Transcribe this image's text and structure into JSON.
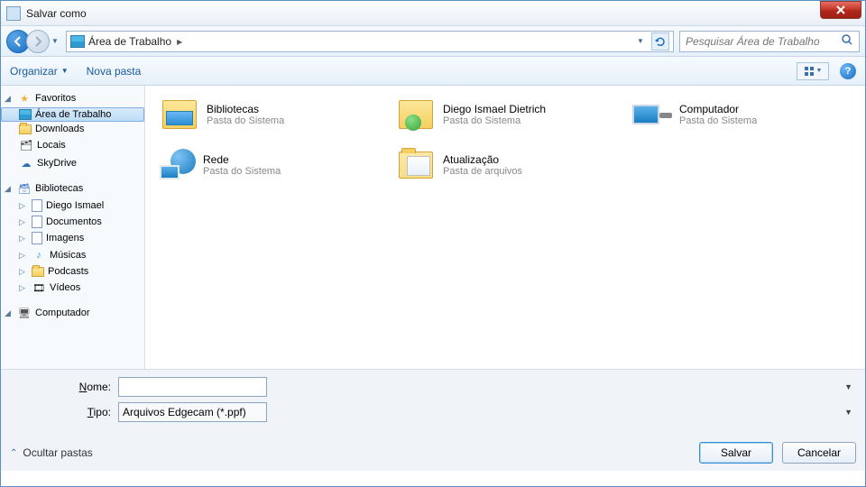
{
  "window": {
    "title": "Salvar como"
  },
  "nav": {
    "location": "Área de Trabalho",
    "search_placeholder": "Pesquisar Área de Trabalho"
  },
  "toolbar": {
    "organize": "Organizar",
    "new_folder": "Nova pasta"
  },
  "sidebar": {
    "favorites": {
      "label": "Favoritos",
      "items": [
        {
          "label": "Área de Trabalho",
          "selected": true,
          "icon": "screen"
        },
        {
          "label": "Downloads",
          "selected": false,
          "icon": "folder"
        },
        {
          "label": "Locais",
          "selected": false,
          "icon": "doc"
        },
        {
          "label": "SkyDrive",
          "selected": false,
          "icon": "cloud"
        }
      ]
    },
    "libraries": {
      "label": "Bibliotecas",
      "items": [
        {
          "label": "Diego Ismael",
          "icon": "doc"
        },
        {
          "label": "Documentos",
          "icon": "doc"
        },
        {
          "label": "Imagens",
          "icon": "doc"
        },
        {
          "label": "Músicas",
          "icon": "music"
        },
        {
          "label": "Podcasts",
          "icon": "folder"
        },
        {
          "label": "Vídeos",
          "icon": "video"
        }
      ]
    },
    "computer": {
      "label": "Computador"
    }
  },
  "content": {
    "items": [
      {
        "name": "Bibliotecas",
        "desc": "Pasta do Sistema",
        "icon": "lib"
      },
      {
        "name": "Diego Ismael Dietrich",
        "desc": "Pasta do Sistema",
        "icon": "user"
      },
      {
        "name": "Computador",
        "desc": "Pasta do Sistema",
        "icon": "pc"
      },
      {
        "name": "Rede",
        "desc": "Pasta do Sistema",
        "icon": "net"
      },
      {
        "name": "Atualização",
        "desc": "Pasta de arquivos",
        "icon": "folder"
      }
    ]
  },
  "form": {
    "name_label": "Nome:",
    "name_value": "",
    "type_label": "Tipo:",
    "type_value": "Arquivos Edgecam (*.ppf)"
  },
  "actions": {
    "hide_folders": "Ocultar pastas",
    "save": "Salvar",
    "cancel": "Cancelar"
  }
}
